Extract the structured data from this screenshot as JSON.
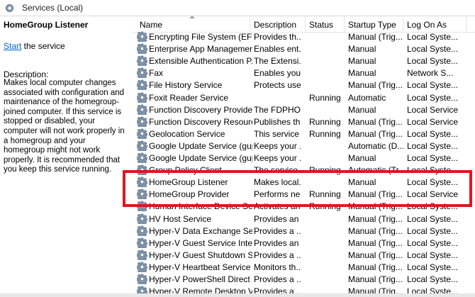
{
  "window": {
    "title": "Services (Local)"
  },
  "left_pane": {
    "service_name": "HomeGroup Listener",
    "start_link": "Start",
    "start_suffix": " the service",
    "description_label": "Description:",
    "description": "Makes local computer changes associated with configuration and maintenance of the homegroup-joined computer. If this service is stopped or disabled, your computer will not work properly in a homegroup and your homegroup might not work properly. It is recommended that you keep this service running."
  },
  "columns": {
    "name": "Name",
    "description": "Description",
    "status": "Status",
    "startup_type": "Startup Type",
    "log_on_as": "Log On As"
  },
  "services": [
    {
      "name": "Encrypting File System (EFS)",
      "description": "Provides th...",
      "status": "",
      "startup": "Manual (Trig...",
      "logon": "Local Syste..."
    },
    {
      "name": "Enterprise App Managemen...",
      "description": "Enables ent...",
      "status": "",
      "startup": "Manual",
      "logon": "Local Syste..."
    },
    {
      "name": "Extensible Authentication P...",
      "description": "The Extensi...",
      "status": "",
      "startup": "Manual",
      "logon": "Local Syste..."
    },
    {
      "name": "Fax",
      "description": "Enables you...",
      "status": "",
      "startup": "Manual",
      "logon": "Network S..."
    },
    {
      "name": "File History Service",
      "description": "Protects use...",
      "status": "",
      "startup": "Manual (Trig...",
      "logon": "Local Syste..."
    },
    {
      "name": "Foxit Reader Service",
      "description": "",
      "status": "Running",
      "startup": "Automatic",
      "logon": "Local Syste..."
    },
    {
      "name": "Function Discovery Provide...",
      "description": "The FDPHO...",
      "status": "",
      "startup": "Manual",
      "logon": "Local Service"
    },
    {
      "name": "Function Discovery Resourc...",
      "description": "Publishes th...",
      "status": "Running",
      "startup": "Manual (Trig...",
      "logon": "Local Service"
    },
    {
      "name": "Geolocation Service",
      "description": "This service ...",
      "status": "Running",
      "startup": "Manual (Trig...",
      "logon": "Local Syste..."
    },
    {
      "name": "Google Update Service (gup...",
      "description": "Keeps your ...",
      "status": "",
      "startup": "Automatic (D...",
      "logon": "Local Syste..."
    },
    {
      "name": "Google Update Service (gup...",
      "description": "Keeps your ...",
      "status": "",
      "startup": "Manual",
      "logon": "Local Syste..."
    },
    {
      "name": "Group Policy Client",
      "description": "The service i...",
      "status": "Running",
      "startup": "Automatic (Tr...",
      "logon": "Local Syste..."
    },
    {
      "name": "HomeGroup Listener",
      "description": "Makes local...",
      "status": "",
      "startup": "Manual",
      "logon": "Local Syste..."
    },
    {
      "name": "HomeGroup Provider",
      "description": "Performs ne...",
      "status": "Running",
      "startup": "Manual (Trig...",
      "logon": "Local Service"
    },
    {
      "name": "Human Interface Device Ser...",
      "description": "Activates an...",
      "status": "Running",
      "startup": "Manual (Trig...",
      "logon": "Local Syste..."
    },
    {
      "name": "HV Host Service",
      "description": "Provides an ...",
      "status": "",
      "startup": "Manual (Trig...",
      "logon": "Local Syste..."
    },
    {
      "name": "Hyper-V Data Exchange Ser...",
      "description": "Provides a ...",
      "status": "",
      "startup": "Manual (Trig...",
      "logon": "Local Syste..."
    },
    {
      "name": "Hyper-V Guest Service Inter...",
      "description": "Provides an ...",
      "status": "",
      "startup": "Manual (Trig...",
      "logon": "Local Syste..."
    },
    {
      "name": "Hyper-V Guest Shutdown S...",
      "description": "Provides a ...",
      "status": "",
      "startup": "Manual (Trig...",
      "logon": "Local Syste..."
    },
    {
      "name": "Hyper-V Heartbeat Service",
      "description": "Monitors th...",
      "status": "",
      "startup": "Manual (Trig...",
      "logon": "Local Syste..."
    },
    {
      "name": "Hyper-V PowerShell Direct ...",
      "description": "Provides a ...",
      "status": "",
      "startup": "Manual (Trig...",
      "logon": "Local Syste..."
    },
    {
      "name": "Hyper-V Remote Desktop Vi...",
      "description": "Provides a ...",
      "status": "",
      "startup": "Manual (Trig...",
      "logon": "Local Syste..."
    }
  ],
  "icons": {
    "service": "gear-icon",
    "window": "services-icon"
  },
  "colors": {
    "highlight": "#e3141e",
    "link": "#0066cc"
  }
}
